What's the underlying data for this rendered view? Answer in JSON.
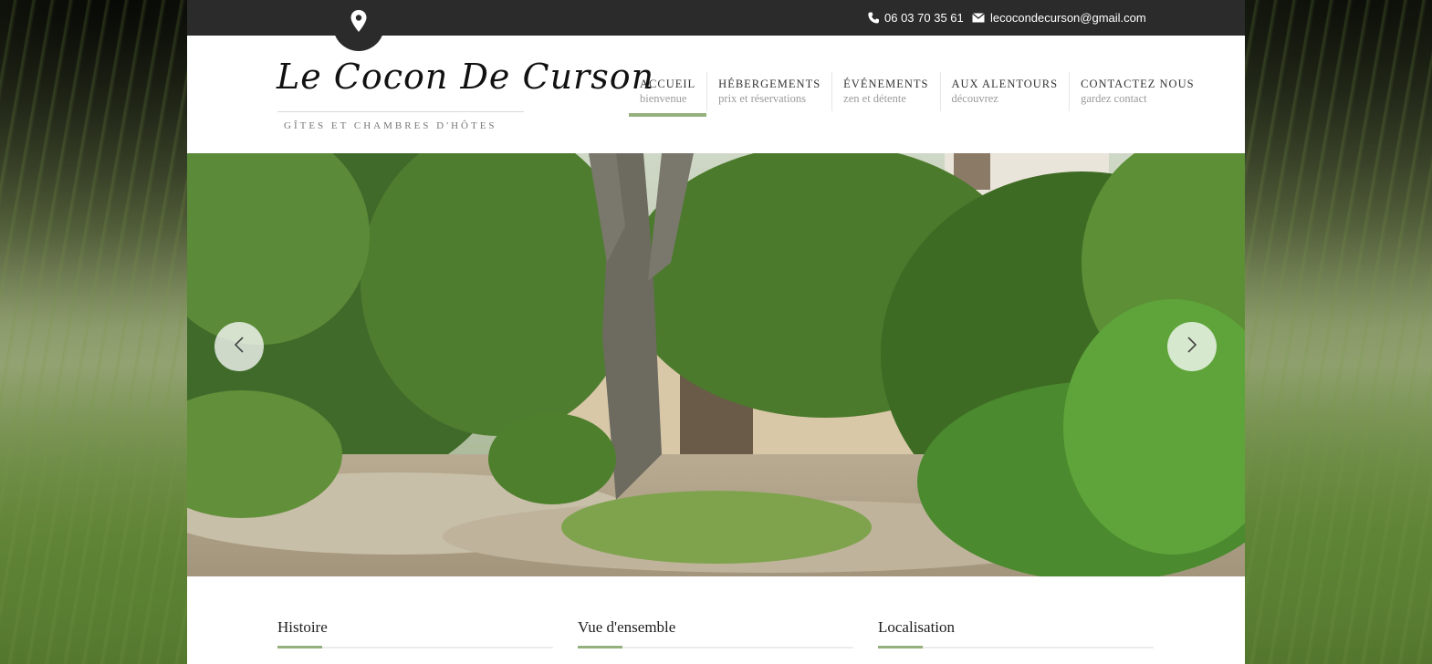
{
  "topbar": {
    "phone": "06 03 70 35 61",
    "email": "lecocondecurson@gmail.com",
    "icons": [
      "map-pin-icon",
      "phone-icon",
      "envelope-icon"
    ]
  },
  "brand": {
    "name": "Le Cocon De Curson",
    "tagline": "GÎTES ET CHAMBRES D'HÔTES"
  },
  "nav": [
    {
      "title": "ACCUEIL",
      "subtitle": "bienvenue",
      "active": true
    },
    {
      "title": "HÉBERGEMENTS",
      "subtitle": "prix et réservations",
      "active": false
    },
    {
      "title": "ÉVÉNEMENTS",
      "subtitle": "zen et détente",
      "active": false
    },
    {
      "title": "AUX ALENTOURS",
      "subtitle": "découvrez",
      "active": false
    },
    {
      "title": "CONTACTEZ NOUS",
      "subtitle": "gardez contact",
      "active": false
    }
  ],
  "slider": {
    "prev_icon": "chevron-left-icon",
    "next_icon": "chevron-right-icon"
  },
  "sections": [
    {
      "title": "Histoire"
    },
    {
      "title": "Vue d'ensemble"
    },
    {
      "title": "Localisation"
    }
  ],
  "colors": {
    "topbar": "#2b2b2b",
    "accent": "#94b17d",
    "page": "#ffffff"
  }
}
